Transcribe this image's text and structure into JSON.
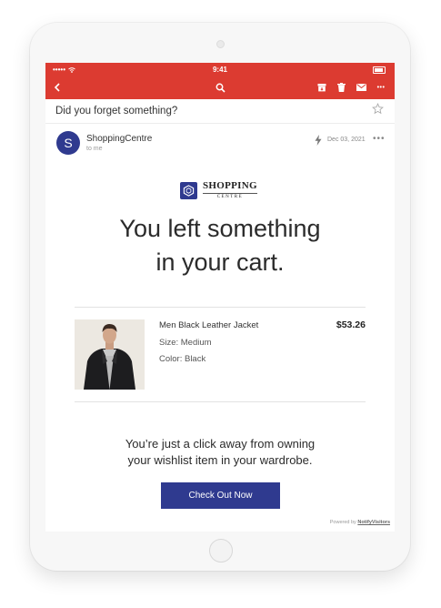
{
  "status_bar": {
    "signal": "•••••",
    "time": "9:41",
    "icons": [
      "wifi-icon",
      "battery-icon"
    ]
  },
  "toolbar": {
    "icons": [
      "back-arrow-icon",
      "search-icon",
      "archive-icon",
      "trash-icon",
      "mail-icon",
      "more-icon"
    ],
    "more_label": "•••"
  },
  "email": {
    "subject": "Did you forget something?",
    "sender": {
      "initial": "S",
      "name": "ShoppingCentre",
      "to": "to me"
    },
    "date": "Dec 03, 2021",
    "more_label": "•••"
  },
  "body": {
    "logo": {
      "main": "SHOPPING",
      "sub": "CENTRE"
    },
    "headline_line1": "You left something",
    "headline_line2": "in your cart.",
    "product": {
      "name": "Men Black Leather Jacket",
      "size": "Size: Medium",
      "color": "Color: Black",
      "price": "$53.26"
    },
    "message_line1": "You’re just a click away from owning",
    "message_line2": "your wishlist item in your wardrobe.",
    "cta_label": "Check Out Now",
    "powered_prefix": "Powered by",
    "powered_brand": "NotifyVisitors"
  },
  "colors": {
    "header_red": "#dc3b31",
    "brand_navy": "#2f3a8f"
  }
}
